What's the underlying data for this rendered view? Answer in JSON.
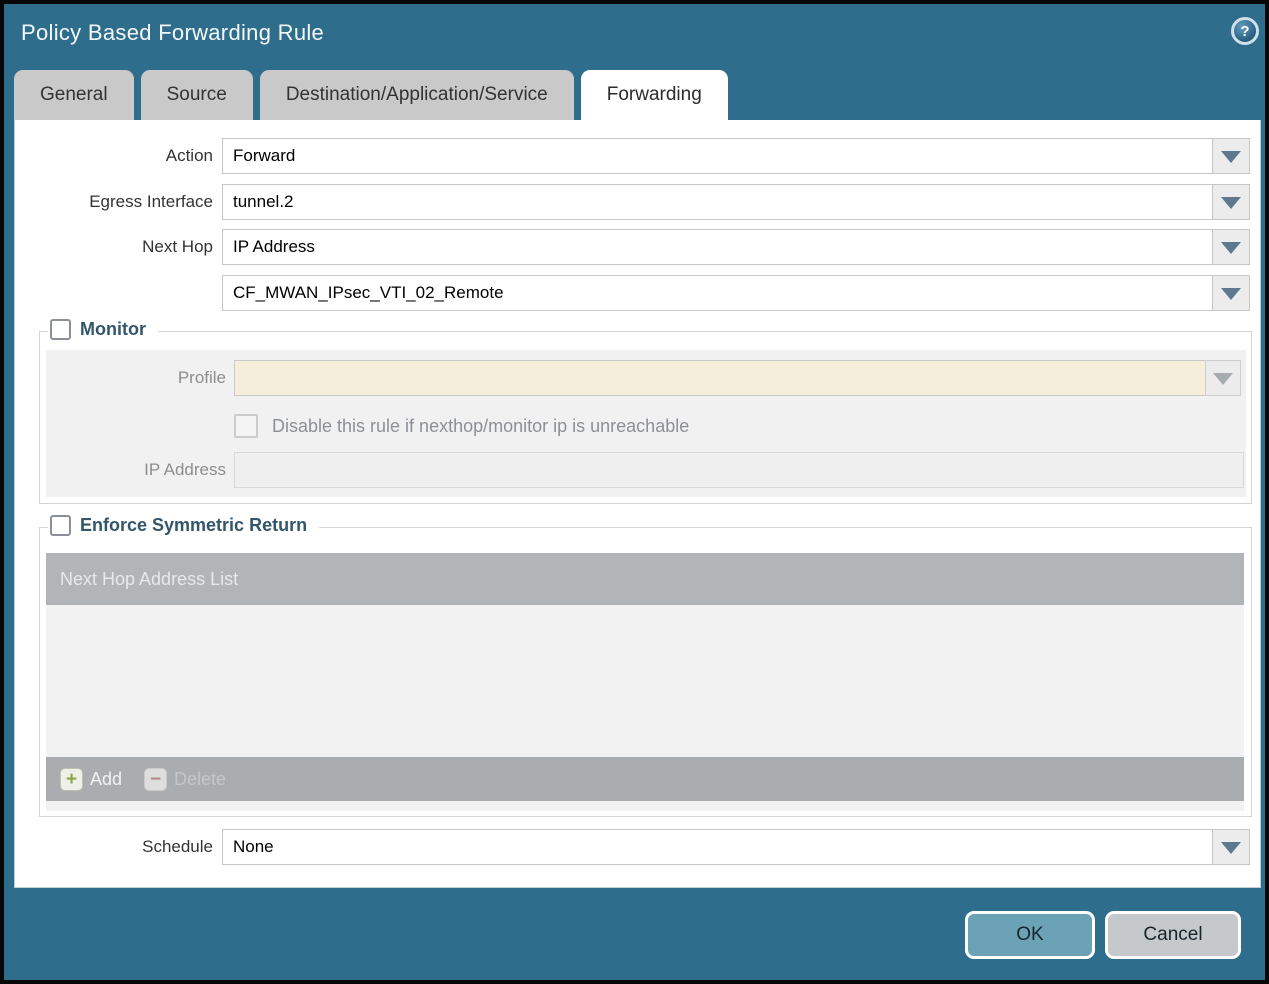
{
  "dialog": {
    "title": "Policy Based Forwarding Rule",
    "help_glyph": "?"
  },
  "tabs": [
    {
      "label": "General",
      "active": false
    },
    {
      "label": "Source",
      "active": false
    },
    {
      "label": "Destination/Application/Service",
      "active": false
    },
    {
      "label": "Forwarding",
      "active": true
    }
  ],
  "form": {
    "action": {
      "label": "Action",
      "value": "Forward"
    },
    "egress_interface": {
      "label": "Egress Interface",
      "value": "tunnel.2"
    },
    "next_hop": {
      "label": "Next Hop",
      "value": "IP Address"
    },
    "next_hop_address": {
      "value": "CF_MWAN_IPsec_VTI_02_Remote"
    },
    "schedule": {
      "label": "Schedule",
      "value": "None"
    }
  },
  "monitor": {
    "legend": "Monitor",
    "checked": false,
    "profile": {
      "label": "Profile",
      "value": ""
    },
    "disable_rule": {
      "label": "Disable this rule if nexthop/monitor ip is unreachable",
      "checked": false
    },
    "ip_address": {
      "label": "IP Address",
      "value": ""
    }
  },
  "symmetric_return": {
    "legend": "Enforce Symmetric Return",
    "checked": false,
    "table": {
      "header": "Next Hop Address List",
      "rows": []
    },
    "add_label": "Add",
    "delete_label": "Delete"
  },
  "footer": {
    "ok_label": "OK",
    "cancel_label": "Cancel"
  },
  "colors": {
    "titlebar": "#2f6d8d",
    "tab_inactive": "#c9c9c9",
    "legend_text": "#33566b",
    "disabled_combobox": "#f5eedb",
    "table_header": "#b1b5b7",
    "table_footer": "#a9adb0",
    "ok_button": "#6ba2b6",
    "cancel_button": "#c6c9cb",
    "dropdown_arrow": "#5e7890"
  }
}
